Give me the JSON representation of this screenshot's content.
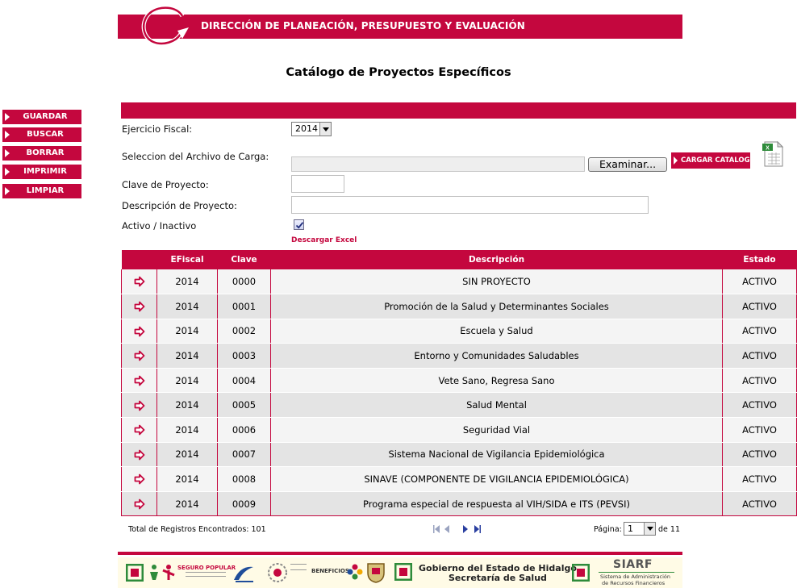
{
  "header": {
    "title": "DIRECCIÓN DE PLANEACIÓN, PRESUPUESTO Y EVALUACIÓN"
  },
  "page_title": "Catálogo de Proyectos Específicos",
  "side_menu": [
    {
      "label": "GUARDAR"
    },
    {
      "label": "BUSCAR"
    },
    {
      "label": "BORRAR"
    },
    {
      "label": "IMPRIMIR"
    },
    {
      "label": "LIMPIAR"
    }
  ],
  "form": {
    "fiscal_year_label": "Ejercicio Fiscal:",
    "fiscal_year_value": "2014",
    "file_label": "Seleccion del Archivo de Carga:",
    "browse_label": "Examinar...",
    "load_label": "CARGAR CATALOGO",
    "project_key_label": "Clave de Proyecto:",
    "project_key_value": "",
    "project_desc_label": "Descripción de Proyecto:",
    "project_desc_value": "",
    "active_label": "Activo / Inactivo",
    "active_checked": true,
    "excel_link": "Descargar Excel"
  },
  "table": {
    "columns": [
      "",
      "EFiscal",
      "Clave",
      "Descripción",
      "Estado"
    ],
    "rows": [
      {
        "year": "2014",
        "key": "0000",
        "description": "SIN PROYECTO",
        "status": "ACTIVO"
      },
      {
        "year": "2014",
        "key": "0001",
        "description": "Promoción de la Salud y Determinantes Sociales",
        "status": "ACTIVO"
      },
      {
        "year": "2014",
        "key": "0002",
        "description": "Escuela y Salud",
        "status": "ACTIVO"
      },
      {
        "year": "2014",
        "key": "0003",
        "description": "Entorno y Comunidades Saludables",
        "status": "ACTIVO"
      },
      {
        "year": "2014",
        "key": "0004",
        "description": "Vete Sano, Regresa Sano",
        "status": "ACTIVO"
      },
      {
        "year": "2014",
        "key": "0005",
        "description": "Salud Mental",
        "status": "ACTIVO"
      },
      {
        "year": "2014",
        "key": "0006",
        "description": "Seguridad Vial",
        "status": "ACTIVO"
      },
      {
        "year": "2014",
        "key": "0007",
        "description": "Sistema Nacional de Vigilancia Epidemiológica",
        "status": "ACTIVO"
      },
      {
        "year": "2014",
        "key": "0008",
        "description": "SINAVE (COMPONENTE DE VIGILANCIA EPIDEMIOLÓGICA)",
        "status": "ACTIVO"
      },
      {
        "year": "2014",
        "key": "0009",
        "description": "Programa especial de respuesta al VIH/SIDA e ITS (PEVSI)",
        "status": "ACTIVO"
      }
    ]
  },
  "pagination": {
    "total_text": "Total de Registros Encontrados: 101",
    "page_label": "Página:",
    "page_value": "1",
    "of_text": "de 11"
  },
  "footer": {
    "seguro_popular": "SEGURO POPULAR",
    "beneficios": "BENEFICIOS",
    "gobierno": "Gobierno del Estado de Hidalgo",
    "secretaria": "Secretaría de Salud",
    "siarf": "SIARF",
    "siarf_sub1": "Sistema de Administración",
    "siarf_sub2": "de Recursos Financieros"
  },
  "colors": {
    "brand": "#c4073e",
    "row_light": "#f4f4f4",
    "row_dark": "#e4e4e4"
  },
  "icons": [
    "logo-swirl-icon",
    "play-arrow-icon",
    "excel-file-icon",
    "checkmark-icon",
    "row-arrow-icon",
    "first-page-icon",
    "prev-page-icon",
    "next-page-icon",
    "last-page-icon"
  ]
}
